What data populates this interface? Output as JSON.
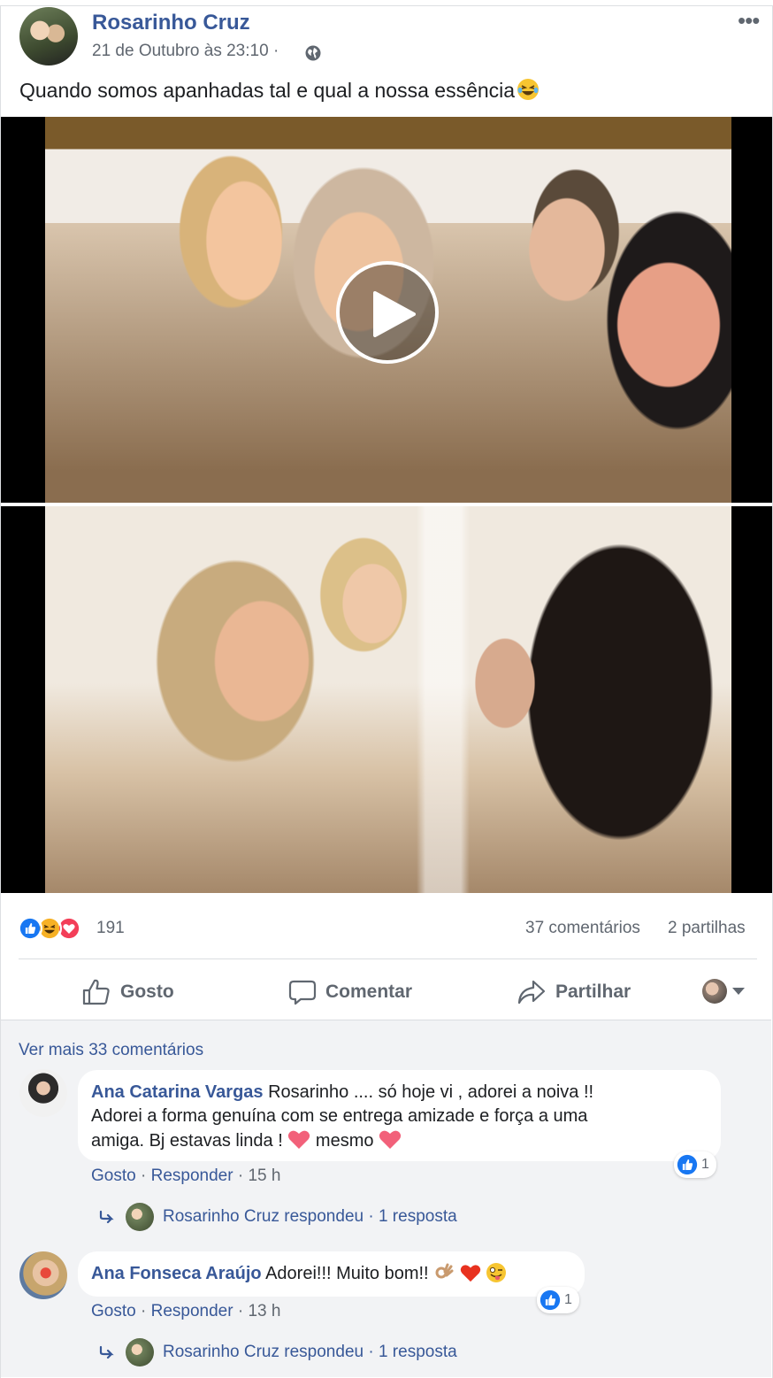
{
  "post": {
    "author": "Rosarinho Cruz",
    "timestamp": "21 de Outubro às 23:10",
    "separator": "·",
    "text": "Quando somos apanhadas tal e qual a nossa essência",
    "more_label": "•••"
  },
  "stats": {
    "reaction_count": "191",
    "comments": "37 comentários",
    "shares": "2 partilhas"
  },
  "actions": {
    "like": "Gosto",
    "comment": "Comentar",
    "share": "Partilhar"
  },
  "comments_section": {
    "view_more": "Ver mais 33 comentários",
    "comments": [
      {
        "name": "Ana Catarina Vargas",
        "text_1": "Rosarinho .... só hoje vi , adorei a noiva !!",
        "text_2": "Adorei a forma genuína com se entrega amizade e força a uma",
        "text_3": "amiga. Bj estavas linda !",
        "text_4": "mesmo",
        "likes": "1",
        "like_action": "Gosto",
        "reply_action": "Responder",
        "age": "15 h",
        "reply_summary": "Rosarinho Cruz respondeu · 1 resposta"
      },
      {
        "name": "Ana Fonseca Araújo",
        "text_1": "Adorei!!! Muito bom!!",
        "likes": "1",
        "like_action": "Gosto",
        "reply_action": "Responder",
        "age": "13 h",
        "reply_summary": "Rosarinho Cruz respondeu · 1 resposta"
      }
    ]
  },
  "colors": {
    "link_blue": "#385898",
    "meta_gray": "#606770",
    "like_blue": "#1877f2",
    "haha_yellow": "#f7b125",
    "love_red": "#f33e58"
  }
}
